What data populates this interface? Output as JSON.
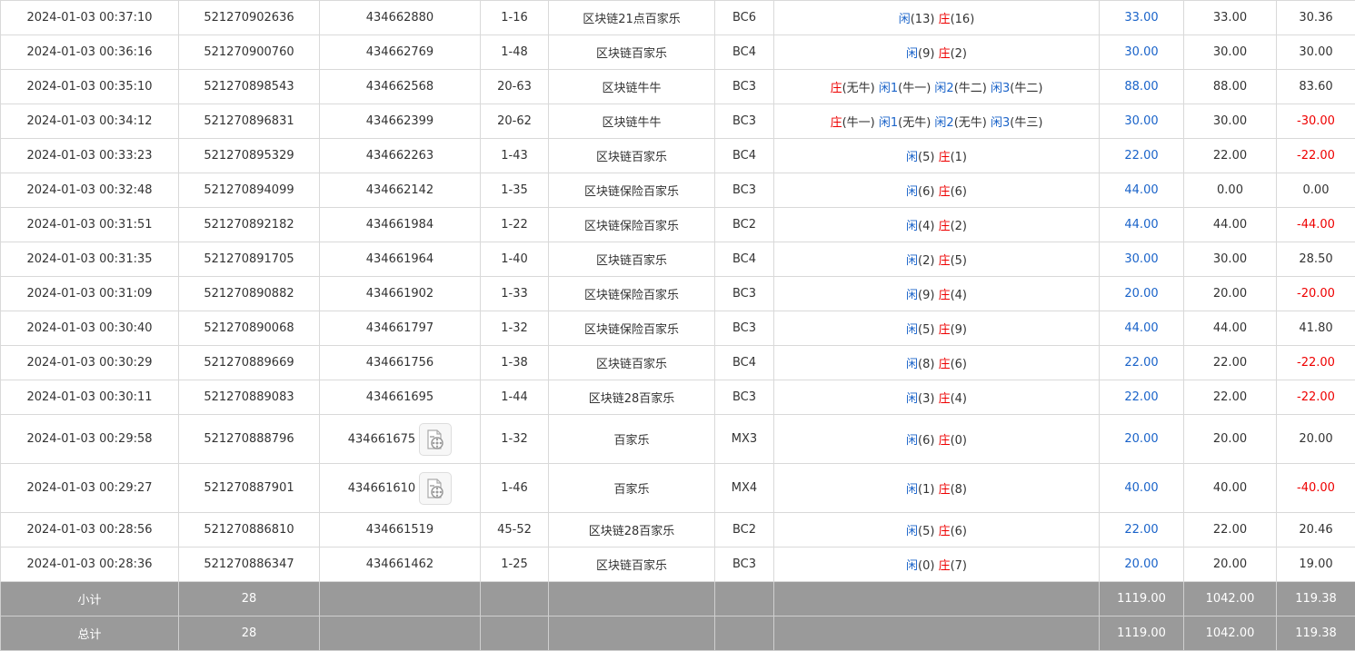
{
  "rows": [
    {
      "time": "2024-01-03 00:37:10",
      "bet_id": "521270902636",
      "round_id": "434662880",
      "has_video": false,
      "table": "1-16",
      "game": "区块链21点百家乐",
      "code": "BC6",
      "result": [
        {
          "text": "闲",
          "color": "blue"
        },
        {
          "text": "(13) ",
          "color": "dark"
        },
        {
          "text": "庄",
          "color": "red"
        },
        {
          "text": "(16)",
          "color": "dark"
        }
      ],
      "bet": "33.00",
      "valid": "33.00",
      "win": "30.36",
      "win_neg": false
    },
    {
      "time": "2024-01-03 00:36:16",
      "bet_id": "521270900760",
      "round_id": "434662769",
      "has_video": false,
      "table": "1-48",
      "game": "区块链百家乐",
      "code": "BC4",
      "result": [
        {
          "text": "闲",
          "color": "blue"
        },
        {
          "text": "(9) ",
          "color": "dark"
        },
        {
          "text": "庄",
          "color": "red"
        },
        {
          "text": "(2)",
          "color": "dark"
        }
      ],
      "bet": "30.00",
      "valid": "30.00",
      "win": "30.00",
      "win_neg": false
    },
    {
      "time": "2024-01-03 00:35:10",
      "bet_id": "521270898543",
      "round_id": "434662568",
      "has_video": false,
      "table": "20-63",
      "game": "区块链牛牛",
      "code": "BC3",
      "result": [
        {
          "text": "庄",
          "color": "red"
        },
        {
          "text": "(无牛) ",
          "color": "dark"
        },
        {
          "text": "闲1",
          "color": "blue"
        },
        {
          "text": "(牛一) ",
          "color": "dark"
        },
        {
          "text": "闲2",
          "color": "blue"
        },
        {
          "text": "(牛二) ",
          "color": "dark"
        },
        {
          "text": "闲3",
          "color": "blue"
        },
        {
          "text": "(牛二)",
          "color": "dark"
        }
      ],
      "bet": "88.00",
      "valid": "88.00",
      "win": "83.60",
      "win_neg": false
    },
    {
      "time": "2024-01-03 00:34:12",
      "bet_id": "521270896831",
      "round_id": "434662399",
      "has_video": false,
      "table": "20-62",
      "game": "区块链牛牛",
      "code": "BC3",
      "result": [
        {
          "text": "庄",
          "color": "red"
        },
        {
          "text": "(牛一) ",
          "color": "dark"
        },
        {
          "text": "闲1",
          "color": "blue"
        },
        {
          "text": "(无牛) ",
          "color": "dark"
        },
        {
          "text": "闲2",
          "color": "blue"
        },
        {
          "text": "(无牛) ",
          "color": "dark"
        },
        {
          "text": "闲3",
          "color": "blue"
        },
        {
          "text": "(牛三)",
          "color": "dark"
        }
      ],
      "bet": "30.00",
      "valid": "30.00",
      "win": "-30.00",
      "win_neg": true
    },
    {
      "time": "2024-01-03 00:33:23",
      "bet_id": "521270895329",
      "round_id": "434662263",
      "has_video": false,
      "table": "1-43",
      "game": "区块链百家乐",
      "code": "BC4",
      "result": [
        {
          "text": "闲",
          "color": "blue"
        },
        {
          "text": "(5) ",
          "color": "dark"
        },
        {
          "text": "庄",
          "color": "red"
        },
        {
          "text": "(1)",
          "color": "dark"
        }
      ],
      "bet": "22.00",
      "valid": "22.00",
      "win": "-22.00",
      "win_neg": true
    },
    {
      "time": "2024-01-03 00:32:48",
      "bet_id": "521270894099",
      "round_id": "434662142",
      "has_video": false,
      "table": "1-35",
      "game": "区块链保险百家乐",
      "code": "BC3",
      "result": [
        {
          "text": "闲",
          "color": "blue"
        },
        {
          "text": "(6) ",
          "color": "dark"
        },
        {
          "text": "庄",
          "color": "red"
        },
        {
          "text": "(6)",
          "color": "dark"
        }
      ],
      "bet": "44.00",
      "valid": "0.00",
      "win": "0.00",
      "win_neg": false
    },
    {
      "time": "2024-01-03 00:31:51",
      "bet_id": "521270892182",
      "round_id": "434661984",
      "has_video": false,
      "table": "1-22",
      "game": "区块链保险百家乐",
      "code": "BC2",
      "result": [
        {
          "text": "闲",
          "color": "blue"
        },
        {
          "text": "(4) ",
          "color": "dark"
        },
        {
          "text": "庄",
          "color": "red"
        },
        {
          "text": "(2)",
          "color": "dark"
        }
      ],
      "bet": "44.00",
      "valid": "44.00",
      "win": "-44.00",
      "win_neg": true
    },
    {
      "time": "2024-01-03 00:31:35",
      "bet_id": "521270891705",
      "round_id": "434661964",
      "has_video": false,
      "table": "1-40",
      "game": "区块链百家乐",
      "code": "BC4",
      "result": [
        {
          "text": "闲",
          "color": "blue"
        },
        {
          "text": "(2) ",
          "color": "dark"
        },
        {
          "text": "庄",
          "color": "red"
        },
        {
          "text": "(5)",
          "color": "dark"
        }
      ],
      "bet": "30.00",
      "valid": "30.00",
      "win": "28.50",
      "win_neg": false
    },
    {
      "time": "2024-01-03 00:31:09",
      "bet_id": "521270890882",
      "round_id": "434661902",
      "has_video": false,
      "table": "1-33",
      "game": "区块链保险百家乐",
      "code": "BC3",
      "result": [
        {
          "text": "闲",
          "color": "blue"
        },
        {
          "text": "(9) ",
          "color": "dark"
        },
        {
          "text": "庄",
          "color": "red"
        },
        {
          "text": "(4)",
          "color": "dark"
        }
      ],
      "bet": "20.00",
      "valid": "20.00",
      "win": "-20.00",
      "win_neg": true
    },
    {
      "time": "2024-01-03 00:30:40",
      "bet_id": "521270890068",
      "round_id": "434661797",
      "has_video": false,
      "table": "1-32",
      "game": "区块链保险百家乐",
      "code": "BC3",
      "result": [
        {
          "text": "闲",
          "color": "blue"
        },
        {
          "text": "(5) ",
          "color": "dark"
        },
        {
          "text": "庄",
          "color": "red"
        },
        {
          "text": "(9)",
          "color": "dark"
        }
      ],
      "bet": "44.00",
      "valid": "44.00",
      "win": "41.80",
      "win_neg": false
    },
    {
      "time": "2024-01-03 00:30:29",
      "bet_id": "521270889669",
      "round_id": "434661756",
      "has_video": false,
      "table": "1-38",
      "game": "区块链百家乐",
      "code": "BC4",
      "result": [
        {
          "text": "闲",
          "color": "blue"
        },
        {
          "text": "(8) ",
          "color": "dark"
        },
        {
          "text": "庄",
          "color": "red"
        },
        {
          "text": "(6)",
          "color": "dark"
        }
      ],
      "bet": "22.00",
      "valid": "22.00",
      "win": "-22.00",
      "win_neg": true
    },
    {
      "time": "2024-01-03 00:30:11",
      "bet_id": "521270889083",
      "round_id": "434661695",
      "has_video": false,
      "table": "1-44",
      "game": "区块链28百家乐",
      "code": "BC3",
      "result": [
        {
          "text": "闲",
          "color": "blue"
        },
        {
          "text": "(3) ",
          "color": "dark"
        },
        {
          "text": "庄",
          "color": "red"
        },
        {
          "text": "(4)",
          "color": "dark"
        }
      ],
      "bet": "22.00",
      "valid": "22.00",
      "win": "-22.00",
      "win_neg": true
    },
    {
      "time": "2024-01-03 00:29:58",
      "bet_id": "521270888796",
      "round_id": "434661675",
      "has_video": true,
      "table": "1-32",
      "game": "百家乐",
      "code": "MX3",
      "result": [
        {
          "text": "闲",
          "color": "blue"
        },
        {
          "text": "(6) ",
          "color": "dark"
        },
        {
          "text": "庄",
          "color": "red"
        },
        {
          "text": "(0)",
          "color": "dark"
        }
      ],
      "bet": "20.00",
      "valid": "20.00",
      "win": "20.00",
      "win_neg": false
    },
    {
      "time": "2024-01-03 00:29:27",
      "bet_id": "521270887901",
      "round_id": "434661610",
      "has_video": true,
      "table": "1-46",
      "game": "百家乐",
      "code": "MX4",
      "result": [
        {
          "text": "闲",
          "color": "blue"
        },
        {
          "text": "(1) ",
          "color": "dark"
        },
        {
          "text": "庄",
          "color": "red"
        },
        {
          "text": "(8)",
          "color": "dark"
        }
      ],
      "bet": "40.00",
      "valid": "40.00",
      "win": "-40.00",
      "win_neg": true
    },
    {
      "time": "2024-01-03 00:28:56",
      "bet_id": "521270886810",
      "round_id": "434661519",
      "has_video": false,
      "table": "45-52",
      "game": "区块链28百家乐",
      "code": "BC2",
      "result": [
        {
          "text": "闲",
          "color": "blue"
        },
        {
          "text": "(5) ",
          "color": "dark"
        },
        {
          "text": "庄",
          "color": "red"
        },
        {
          "text": "(6)",
          "color": "dark"
        }
      ],
      "bet": "22.00",
      "valid": "22.00",
      "win": "20.46",
      "win_neg": false
    },
    {
      "time": "2024-01-03 00:28:36",
      "bet_id": "521270886347",
      "round_id": "434661462",
      "has_video": false,
      "table": "1-25",
      "game": "区块链百家乐",
      "code": "BC3",
      "result": [
        {
          "text": "闲",
          "color": "blue"
        },
        {
          "text": "(0) ",
          "color": "dark"
        },
        {
          "text": "庄",
          "color": "red"
        },
        {
          "text": "(7)",
          "color": "dark"
        }
      ],
      "bet": "20.00",
      "valid": "20.00",
      "win": "19.00",
      "win_neg": false
    }
  ],
  "subtotal": {
    "label": "小计",
    "count": "28",
    "bet": "1119.00",
    "valid": "1042.00",
    "win": "119.38"
  },
  "total": {
    "label": "总计",
    "count": "28",
    "bet": "1119.00",
    "valid": "1042.00",
    "win": "119.38"
  },
  "colors": {
    "blue": "#1a63c9",
    "red": "#e00000",
    "summary_bg": "#9a9a9a"
  },
  "icons": {
    "video": "video-replay-icon"
  }
}
